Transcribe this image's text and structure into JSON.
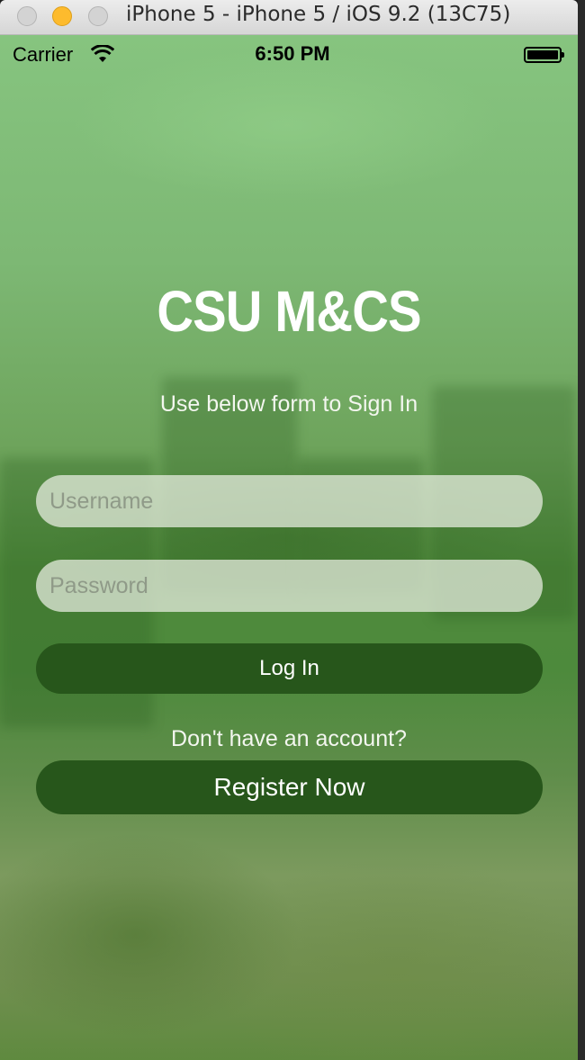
{
  "window": {
    "title": "iPhone 5 - iPhone 5 / iOS 9.2 (13C75)"
  },
  "status_bar": {
    "carrier": "Carrier",
    "time": "6:50 PM",
    "icons": [
      "wifi-icon",
      "battery-icon"
    ]
  },
  "app": {
    "title": "CSU M&CS",
    "subtitle": "Use below form to Sign In"
  },
  "form": {
    "username_placeholder": "Username",
    "username_value": "",
    "password_placeholder": "Password",
    "password_value": "",
    "login_label": "Log In",
    "register_prompt": "Don't have an account?",
    "register_label": "Register Now"
  },
  "colors": {
    "button": "#27561b",
    "background": "#6ea45c",
    "text": "#ffffff"
  }
}
